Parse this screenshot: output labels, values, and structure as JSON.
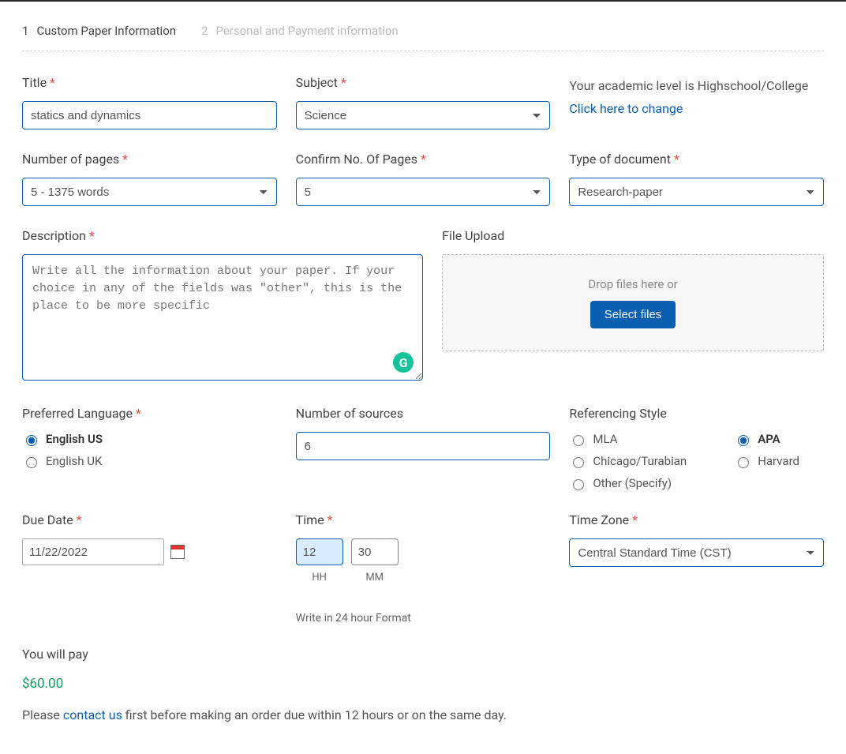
{
  "steps": {
    "s1_num": "1",
    "s1_label": "Custom Paper Information",
    "s2_num": "2",
    "s2_label": "Personal and Payment information"
  },
  "title": {
    "label": "Title",
    "value": "statics and dynamics"
  },
  "subject": {
    "label": "Subject",
    "value": "Science"
  },
  "academic_notice": {
    "prefix": "Your academic level is Highschool/College ",
    "link": "Click here to change"
  },
  "num_pages": {
    "label": "Number of pages",
    "value": "5 - 1375 words"
  },
  "confirm_pages": {
    "label": "Confirm No. Of Pages",
    "value": "5"
  },
  "doc_type": {
    "label": "Type of document",
    "value": "Research-paper"
  },
  "description": {
    "label": "Description",
    "placeholder": "Write all the information about your paper. If your choice in any of the fields was \"other\", this is the place to be more specific"
  },
  "file_upload": {
    "label": "File Upload",
    "drop_text": "Drop files here or",
    "button": "Select files"
  },
  "language": {
    "label": "Preferred Language",
    "opt_us": "English US",
    "opt_uk": "English UK",
    "selected": "us"
  },
  "num_sources": {
    "label": "Number of sources",
    "value": "6"
  },
  "ref_style": {
    "label": "Referencing Style",
    "mla": "MLA",
    "apa": "APA",
    "chicago": "Chicago/Turabian",
    "harvard": "Harvard",
    "other": "Other (Specify)",
    "selected": "apa"
  },
  "due_date": {
    "label": "Due Date",
    "value": "11/22/2022"
  },
  "time": {
    "label": "Time",
    "hh": "12",
    "mm": "30",
    "hh_label": "HH",
    "mm_label": "MM",
    "note": "Write in 24 hour Format"
  },
  "timezone": {
    "label": "Time Zone",
    "value": "Central Standard Time (CST)"
  },
  "payment": {
    "heading": "You will pay",
    "amount": "$60.00",
    "notice_pre": "Please ",
    "notice_link": "contact us",
    "notice_post": " first before making an order due within 12 hours or on the same day."
  }
}
